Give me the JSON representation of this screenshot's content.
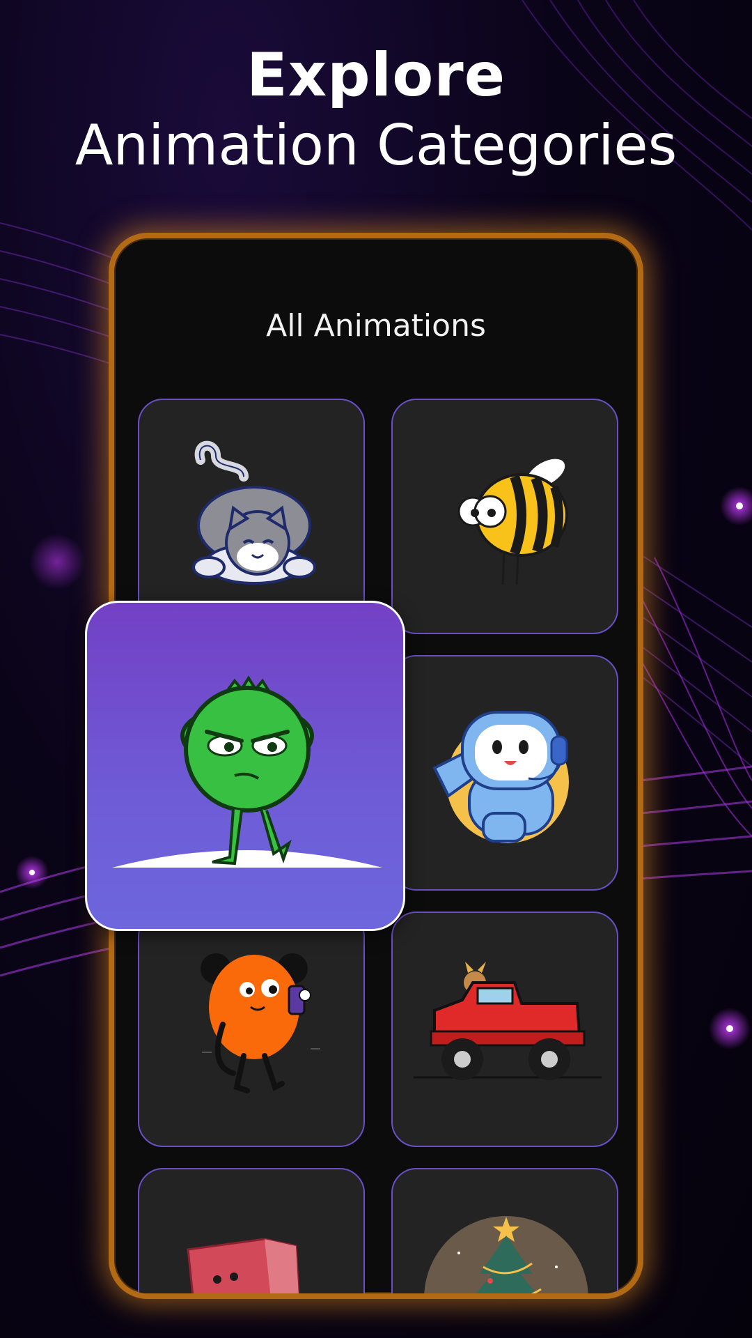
{
  "header": {
    "title_line1": "Explore",
    "title_line2": "Animation Categories"
  },
  "screen": {
    "title": "All Animations",
    "cards": [
      {
        "icon": "cat-icon"
      },
      {
        "icon": "bee-icon"
      },
      {
        "icon": "robot-icon"
      },
      {
        "icon": "orange-character-icon"
      },
      {
        "icon": "monster-truck-icon"
      },
      {
        "icon": "red-box-icon"
      },
      {
        "icon": "christmas-tree-icon"
      }
    ],
    "featured": {
      "icon": "green-character-icon"
    }
  },
  "colors": {
    "device_border": "#b36a14",
    "card_border": "#6a4fc7",
    "card_bg": "#232324",
    "featured_gradient_top": "#7340c4",
    "featured_gradient_bottom": "#6d66dc"
  }
}
